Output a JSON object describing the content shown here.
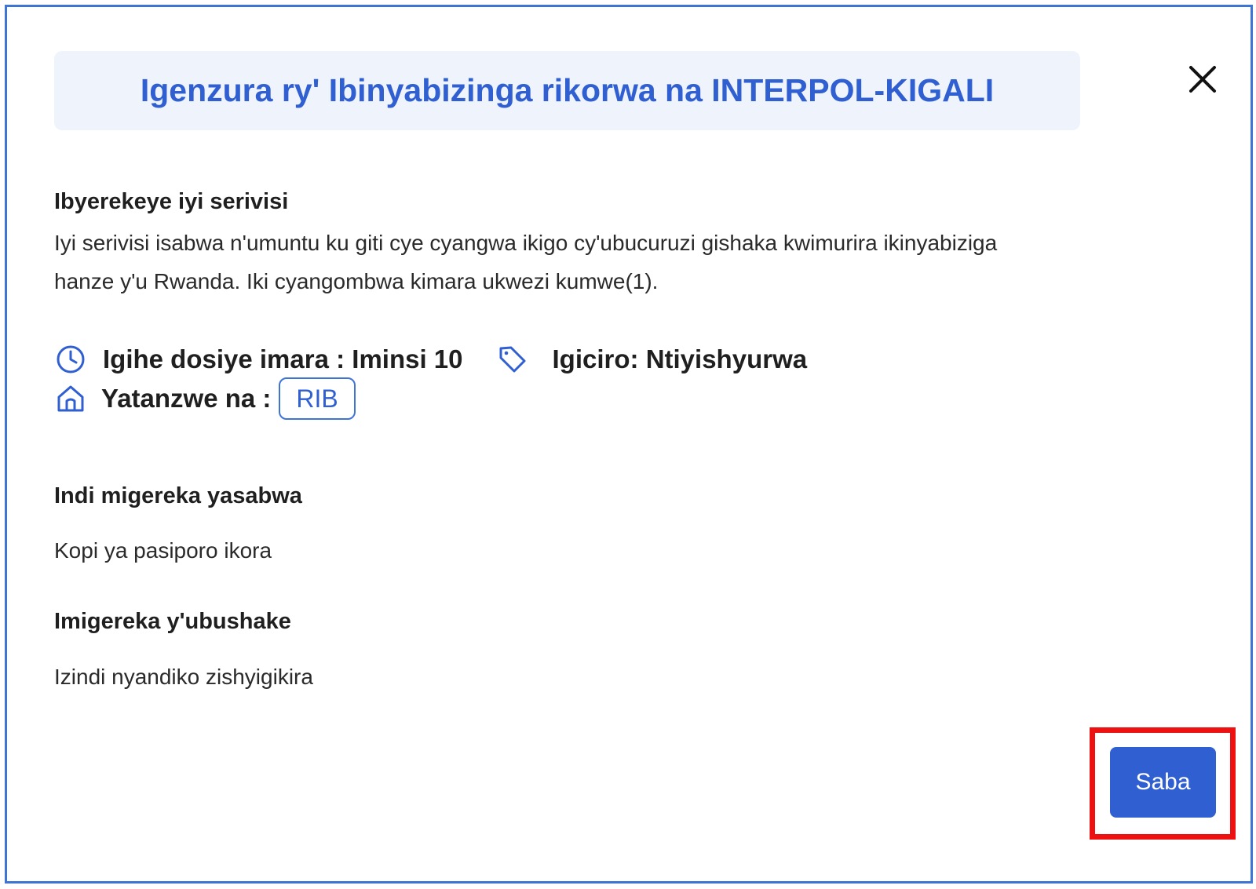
{
  "modal": {
    "title": "Igenzura ry' Ibinyabizinga rikorwa na INTERPOL-KIGALI",
    "close_icon": "close-icon"
  },
  "about": {
    "heading": "Ibyerekeye iyi serivisi",
    "line1": "Iyi serivisi isabwa n'umuntu ku giti cye cyangwa ikigo cy'ubucuruzi gishaka kwimurira ikinyabiziga",
    "line2": "hanze y'u Rwanda. Iki cyangombwa kimara ukwezi kumwe(1)."
  },
  "meta": {
    "duration_icon": "clock-icon",
    "duration_label": "Igihe dosiye imara : Iminsi 10",
    "price_icon": "tag-icon",
    "price_label": "Igiciro: Ntiyishyurwa",
    "provider_icon": "home-icon",
    "provider_label": "Yatanzwe na :",
    "provider_name": "RIB"
  },
  "required_docs": {
    "heading": "Indi migereka yasabwa",
    "item": "Kopi ya pasiporo ikora"
  },
  "optional_docs": {
    "heading": "Imigereka y'ubushake",
    "item": "Izindi nyandiko zishyigikira"
  },
  "actions": {
    "apply_label": "Saba"
  },
  "colors": {
    "accent": "#2f5fd1",
    "header_bg": "#eff4fc",
    "frame_border": "#3d74d6",
    "highlight": "#ee1111"
  }
}
